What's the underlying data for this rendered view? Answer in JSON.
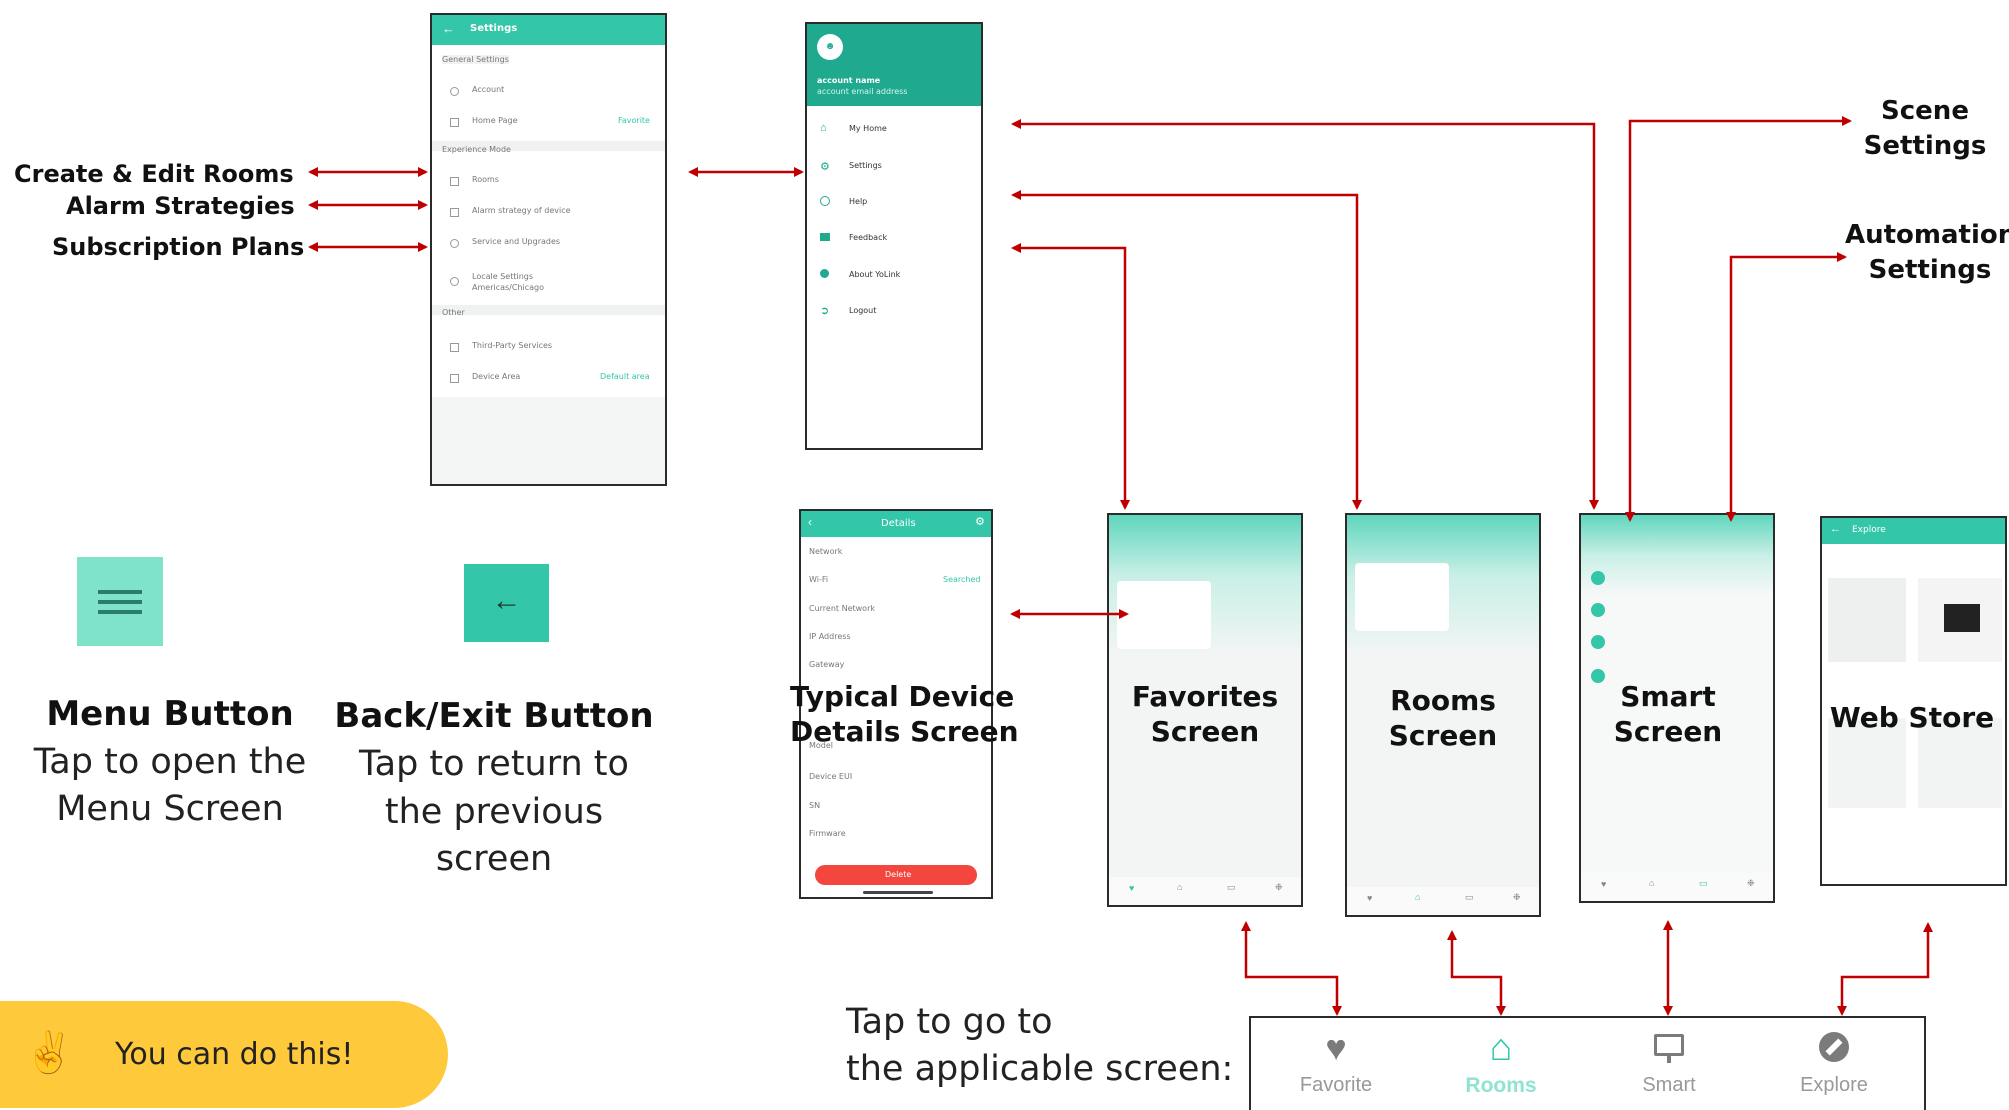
{
  "left_labels": {
    "create_edit_rooms": "Create & Edit Rooms",
    "alarm_strategies": "Alarm Strategies",
    "subscription_plans": "Subscription Plans"
  },
  "settings_screen": {
    "title": "Settings",
    "section_1": "General Settings",
    "rows_1": [
      "Account",
      "Home Page"
    ],
    "home_page_value": "Favorite",
    "section_2": "Experience Mode",
    "rows_2": [
      "Rooms",
      "Alarm strategy of device",
      "Service and Upgrades",
      "Locale Settings"
    ],
    "locale_sub": "Americas/Chicago",
    "section_3": "Other",
    "rows_3": [
      "Third-Party Services",
      "Device Area"
    ],
    "device_area_value": "Default area"
  },
  "menu_screen": {
    "account_name": "account name",
    "account_email": "account email address",
    "items": [
      "My Home",
      "Settings",
      "Help",
      "Feedback",
      "About YoLink",
      "Logout"
    ]
  },
  "buttons": {
    "menu_title": "Menu Button",
    "menu_desc": [
      "Tap to open the",
      "Menu Screen"
    ],
    "back_title": "Back/Exit Button",
    "back_desc": [
      "Tap to return to",
      "the previous",
      "screen"
    ]
  },
  "device_details": {
    "title": "Details",
    "section": "Network",
    "rows": [
      "Wi-Fi",
      "Current Network",
      "IP Address",
      "Gateway",
      "Model",
      "Device EUI",
      "SN",
      "Firmware"
    ],
    "wifi_value": "Searched",
    "delete_button": "Delete",
    "caption": [
      "Typical Device",
      "Details Screen"
    ]
  },
  "screens": {
    "favorites_caption": [
      "Favorites",
      "Screen"
    ],
    "rooms_caption": [
      "Rooms",
      "Screen"
    ],
    "smart_caption": [
      "Smart",
      "Screen"
    ],
    "webstore_caption": "Web Store",
    "webstore_title": "Explore"
  },
  "right_labels": {
    "scene": [
      "Scene",
      "Settings"
    ],
    "automation": [
      "Automation",
      "Settings"
    ]
  },
  "bottom": {
    "tap_text": [
      "Tap to go to",
      "the applicable screen:"
    ],
    "tabs": [
      "Favorite",
      "Rooms",
      "Smart",
      "Explore"
    ]
  },
  "badge": {
    "text": "You can do this!"
  },
  "colors": {
    "teal": "#33c6a8",
    "mint": "#7ee3c9",
    "arrow_red": "#c00000",
    "badge_yellow": "#ffc93c"
  }
}
